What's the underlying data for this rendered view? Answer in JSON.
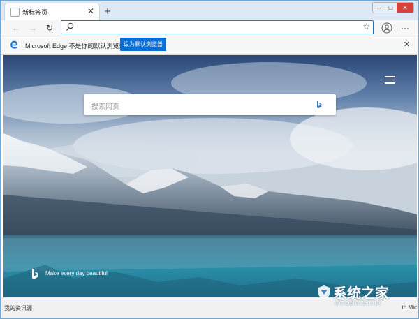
{
  "tab": {
    "title": "新标签页"
  },
  "infobar": {
    "message": "Microsoft Edge 不是你的默认浏览器",
    "set_default_button": "设为默认浏览器"
  },
  "newtab": {
    "search_placeholder": "搜索网页",
    "tagline": "Make every day beautiful"
  },
  "footer": {
    "news_label": "我的资讯源",
    "right_text": "th Mic"
  },
  "watermark": {
    "title": "系统之家",
    "subtitle": "XITONGZHIJIA"
  },
  "colors": {
    "accent": "#0b6ed1",
    "address_border": "#2b6fc6",
    "close_red": "#d8403a"
  }
}
